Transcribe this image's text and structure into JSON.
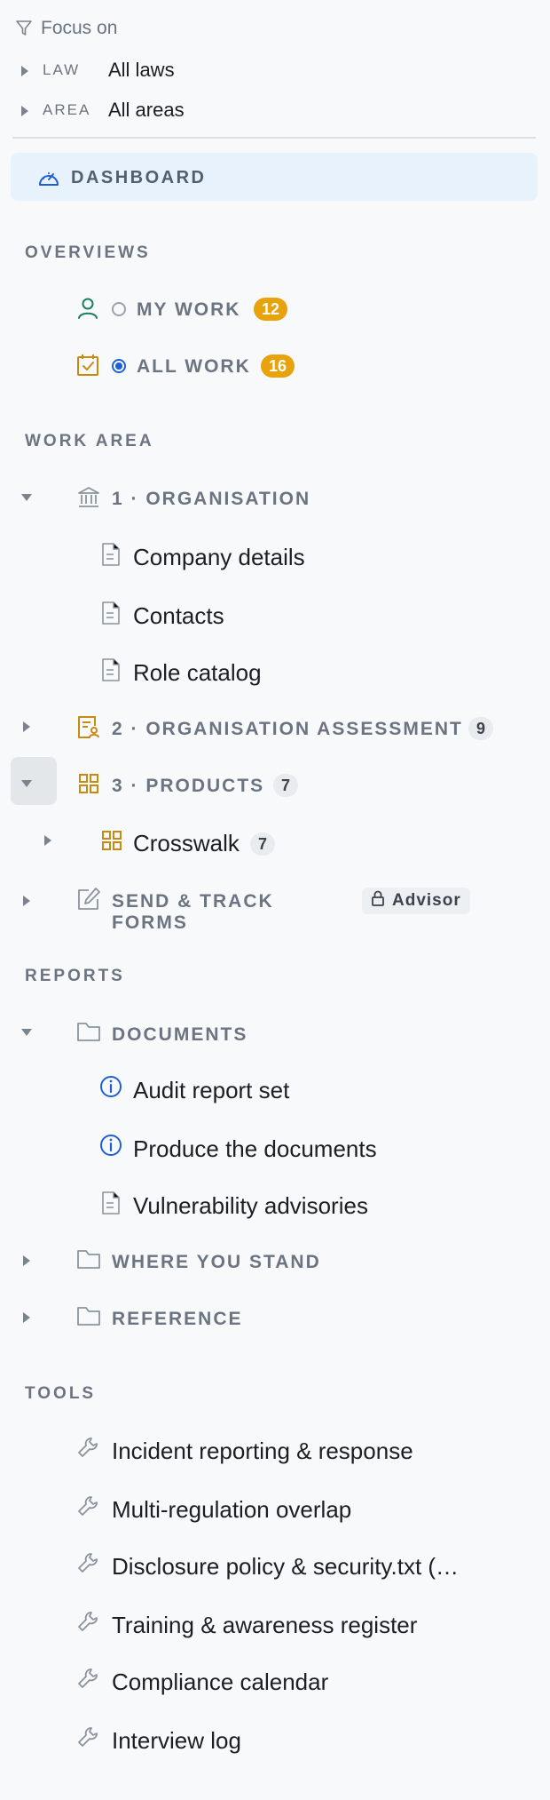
{
  "focus": {
    "label": "Focus on",
    "filters": [
      {
        "key": "LAW",
        "value": "All laws"
      },
      {
        "key": "AREA",
        "value": "All areas"
      }
    ]
  },
  "dashboard": {
    "label": "DASHBOARD"
  },
  "overviews": {
    "heading": "OVERVIEWS",
    "items": [
      {
        "label": "MY WORK",
        "count": "12",
        "selected": false,
        "icon": "person-icon"
      },
      {
        "label": "ALL WORK",
        "count": "16",
        "selected": true,
        "icon": "calendar-check-icon"
      }
    ]
  },
  "work_area": {
    "heading": "WORK AREA",
    "organisation": {
      "label": "1 · ORGANISATION",
      "children": [
        "Company details",
        "Contacts",
        "Role catalog"
      ]
    },
    "assessment": {
      "label": "2 · ORGANISATION ASSESSMENT",
      "count": "9"
    },
    "products": {
      "label": "3 · PRODUCTS",
      "count": "7",
      "children": [
        {
          "label": "Crosswalk",
          "count": "7"
        }
      ]
    },
    "forms": {
      "label": "SEND & TRACK FORMS",
      "tag": "Advisor"
    }
  },
  "reports": {
    "heading": "REPORTS",
    "documents": {
      "label": "DOCUMENTS",
      "children": [
        "Audit report set",
        "Produce the documents",
        "Vulnerability advisories"
      ]
    },
    "where": {
      "label": "WHERE YOU STAND"
    },
    "reference": {
      "label": "REFERENCE"
    }
  },
  "tools": {
    "heading": "TOOLS",
    "items": [
      "Incident reporting & response",
      "Multi-regulation overlap",
      "Disclosure policy & security.txt (…",
      "Training & awareness register",
      "Compliance calendar",
      "Interview log"
    ]
  },
  "colors": {
    "accent_blue": "#1f5fd6",
    "badge_orange": "#e8a20c",
    "icon_green": "#1a7f5a",
    "icon_amber": "#c98a12",
    "dashboard_bg": "#e8f2fc"
  }
}
